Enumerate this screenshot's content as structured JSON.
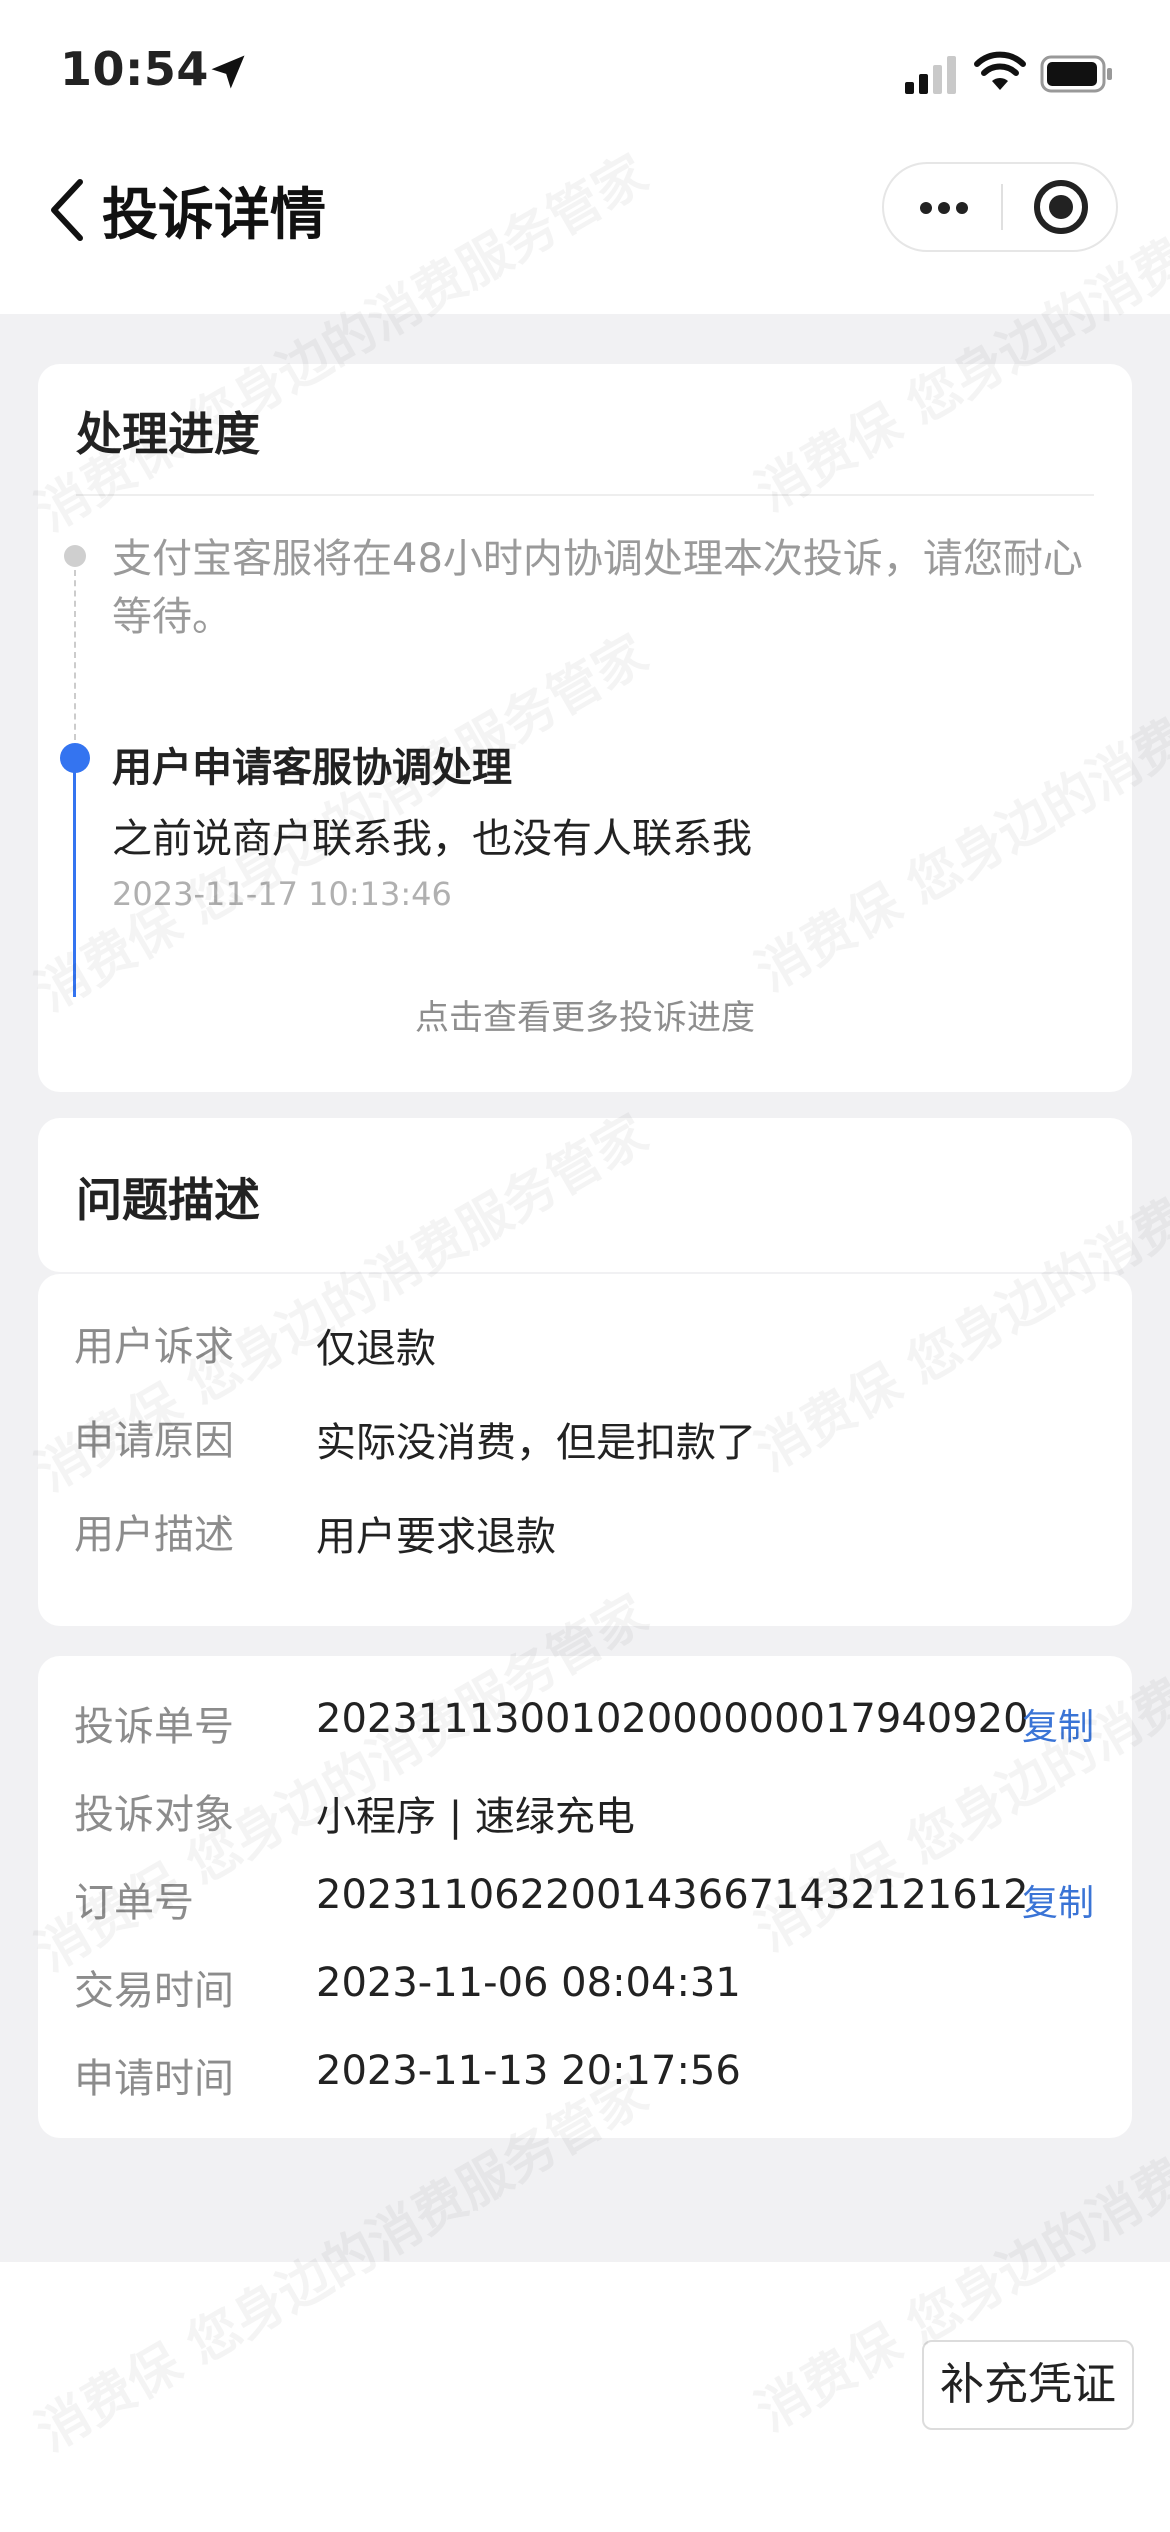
{
  "status_bar": {
    "time": "10:54"
  },
  "nav": {
    "title": "投诉详情"
  },
  "progress": {
    "title": "处理进度",
    "step1_text": "支付宝客服将在48小时内协调处理本次投诉，请您耐心等待。",
    "step2_title": "用户申请客服协调处理",
    "step2_desc": "之前说商户联系我，也没有人联系我",
    "step2_time": "2023-11-17 10:13:46",
    "more_link": "点击查看更多投诉进度"
  },
  "problem": {
    "title": "问题描述",
    "rows": [
      {
        "label": "用户诉求",
        "value": "仅退款"
      },
      {
        "label": "申请原因",
        "value": "实际没消费，但是扣款了"
      },
      {
        "label": "用户描述",
        "value": "用户要求退款"
      }
    ]
  },
  "info": {
    "rows": [
      {
        "label": "投诉单号",
        "value": "2023111300102000000017940920",
        "action": "复制"
      },
      {
        "label": "投诉对象",
        "value": "小程序 | 速绿充电"
      },
      {
        "label": "订单号",
        "value": "2023110622001436671432121612",
        "action": "复制"
      },
      {
        "label": "交易时间",
        "value": "2023-11-06 08:04:31"
      },
      {
        "label": "申请时间",
        "value": "2023-11-13 20:17:56"
      }
    ]
  },
  "bottom": {
    "supplement_button": "补充凭证"
  },
  "watermark_text": "消费保 您身边的消费服务管家",
  "colors": {
    "accent_blue": "#3474f0",
    "link_blue": "#3a74d6",
    "page_bg": "#f1f1f3"
  },
  "icons": [
    "location-arrow-icon",
    "signal-icon",
    "wifi-icon",
    "battery-icon",
    "chevron-left-icon",
    "more-dots-icon",
    "target-close-icon"
  ]
}
